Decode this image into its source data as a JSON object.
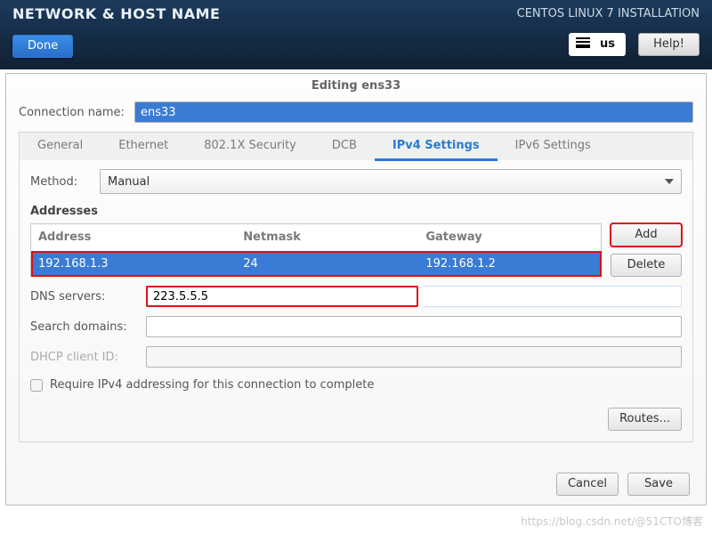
{
  "header": {
    "title": "NETWORK & HOST NAME",
    "product": "CENTOS LINUX 7 INSTALLATION",
    "done": "Done",
    "help": "Help!",
    "kbd_layout": "us"
  },
  "dialog": {
    "title": "Editing ens33",
    "connection_label": "Connection name:",
    "connection_value": "ens33",
    "tabs": {
      "general": "General",
      "ethernet": "Ethernet",
      "security": "802.1X Security",
      "dcb": "DCB",
      "ipv4": "IPv4 Settings",
      "ipv6": "IPv6 Settings"
    },
    "method_label": "Method:",
    "method_value": "Manual",
    "addresses_title": "Addresses",
    "addr_headers": {
      "address": "Address",
      "netmask": "Netmask",
      "gateway": "Gateway"
    },
    "addr_row": {
      "address": "192.168.1.3",
      "netmask": "24",
      "gateway": "192.168.1.2"
    },
    "add": "Add",
    "delete": "Delete",
    "dns_label": "DNS servers:",
    "dns_value": "223.5.5.5",
    "search_label": "Search domains:",
    "search_value": "",
    "dhcp_label": "DHCP client ID:",
    "dhcp_value": "",
    "require_label": "Require IPv4 addressing for this connection to complete",
    "routes": "Routes...",
    "cancel": "Cancel",
    "save": "Save"
  },
  "watermark": "https://blog.csdn.net/@51CTO博客"
}
